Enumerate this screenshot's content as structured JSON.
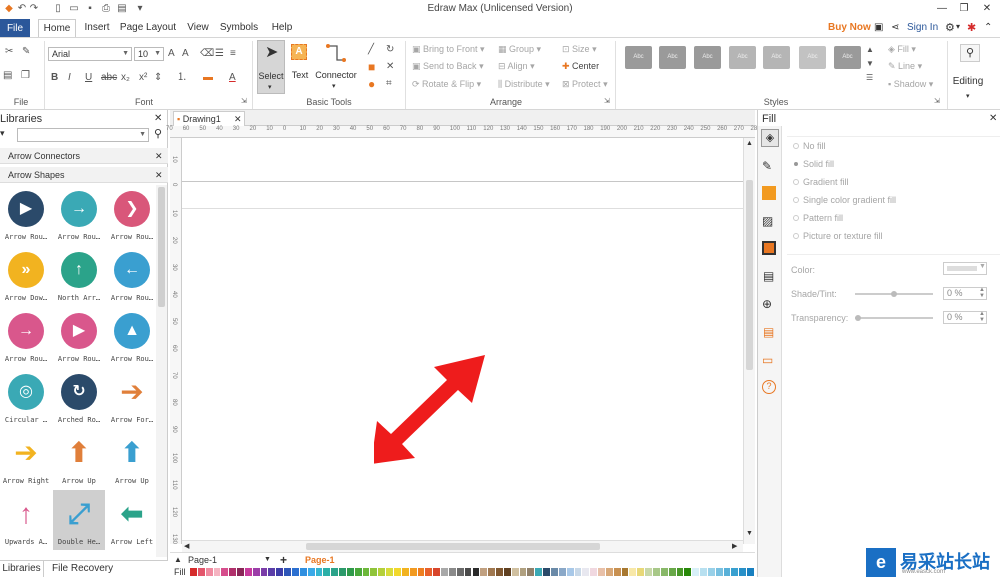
{
  "app": {
    "title": "Edraw Max (Unlicensed Version)"
  },
  "quick_access": [
    "app-icon",
    "undo-icon",
    "redo-icon",
    "new-icon",
    "open-icon",
    "save-icon",
    "print-icon",
    "export-icon",
    "customize-icon"
  ],
  "window_controls": [
    "minimize-icon",
    "restore-icon",
    "close-icon"
  ],
  "tabs": [
    {
      "label": "File"
    },
    {
      "label": "Home"
    },
    {
      "label": "Insert"
    },
    {
      "label": "Page Layout"
    },
    {
      "label": "View"
    },
    {
      "label": "Symbols"
    },
    {
      "label": "Help"
    }
  ],
  "account": {
    "buy_now": "Buy Now",
    "sign_in": "Sign In"
  },
  "ribbon": {
    "groups": {
      "file": "File",
      "font": "Font",
      "basic_tools": "Basic Tools",
      "arrange": "Arrange",
      "styles": "Styles"
    },
    "font_name": "Arial",
    "font_size": "10",
    "tools": {
      "select": "Select",
      "text": "Text",
      "connector": "Connector"
    },
    "arrange": {
      "bring_to_front": "Bring to Front",
      "send_to_back": "Send to Back",
      "rotate_flip": "Rotate & Flip",
      "group": "Group",
      "align": "Align",
      "distribute": "Distribute",
      "size": "Size",
      "center": "Center",
      "protect": "Protect"
    },
    "style_swatch": "Abc",
    "style_options": {
      "fill": "Fill",
      "line": "Line",
      "shadow": "Shadow"
    },
    "editing": "Editing"
  },
  "libraries": {
    "title": "Libraries",
    "search_value": "",
    "sections": [
      "Arrow Connectors",
      "Arrow Shapes"
    ],
    "shapes": [
      {
        "label": "Arrow Rou…",
        "color": "#2b4a6a"
      },
      {
        "label": "Arrow Rou…",
        "color": "#3aa9b5"
      },
      {
        "label": "Arrow Rou…",
        "color": "#d9577a"
      },
      {
        "label": "Arrow Dow…",
        "color": "#f2b320"
      },
      {
        "label": "North Arr…",
        "color": "#2ba38a"
      },
      {
        "label": "Arrow Rou…",
        "color": "#3a9fd0"
      },
      {
        "label": "Arrow Rou…",
        "color": "#d9578c"
      },
      {
        "label": "Arrow Rou…",
        "color": "#d9578c"
      },
      {
        "label": "Arrow Rou…",
        "color": "#3a9fd0"
      },
      {
        "label": "Circular …",
        "color": "#3aa9b5"
      },
      {
        "label": "Arched Ro…",
        "color": "#2b4a6a"
      },
      {
        "label": "Arrow For…",
        "color": "#e07f3a"
      },
      {
        "label": "Arrow Right",
        "color": "#f2b320"
      },
      {
        "label": "Arrow Up",
        "color": "#e07f3a"
      },
      {
        "label": "Arrow Up",
        "color": "#3a9fd0"
      },
      {
        "label": "Upwards A…",
        "color": "#d9578c"
      },
      {
        "label": "Double He…",
        "color": "#3a9fd0"
      },
      {
        "label": "Arrow Left",
        "color": "#2ba38a"
      }
    ],
    "bottom_tabs": [
      "Libraries",
      "File Recovery"
    ]
  },
  "document": {
    "tab": "Drawing1",
    "ruler_h": [
      "70",
      "60",
      "50",
      "40",
      "30",
      "20",
      "10",
      "0",
      "10",
      "20",
      "30",
      "40",
      "50",
      "60",
      "70",
      "80",
      "90",
      "100",
      "110",
      "120",
      "130",
      "140",
      "150",
      "160",
      "170",
      "180",
      "190",
      "200",
      "210",
      "220",
      "230",
      "240",
      "250",
      "260",
      "270",
      "280"
    ],
    "ruler_v": [
      "10",
      "0",
      "10",
      "20",
      "30",
      "40",
      "50",
      "60",
      "70",
      "80",
      "90",
      "100",
      "110",
      "120",
      "130"
    ],
    "arrow_color": "#ee1c1c",
    "page_select": "Page-1",
    "page_tab": "Page-1",
    "fill_label": "Fill"
  },
  "fill_panel": {
    "title": "Fill",
    "options": [
      "No fill",
      "Solid fill",
      "Gradient fill",
      "Single color gradient fill",
      "Pattern fill",
      "Picture or texture fill"
    ],
    "color_label": "Color:",
    "shade_label": "Shade/Tint:",
    "shade_value": "0 %",
    "shade_level": 0.5,
    "transparency_label": "Transparency:",
    "transparency_value": "0 %",
    "transparency_level": 0,
    "strip_icons": [
      "fill-icon",
      "line-icon",
      "shadow-icon",
      "image-icon",
      "layer-icon",
      "page-icon",
      "map-icon",
      "attachment-icon",
      "comment-icon",
      "help-icon"
    ]
  },
  "colors": {
    "accent": "#e87722",
    "palette": [
      "#d52b2b",
      "#e3556b",
      "#f08aa0",
      "#f5b3c1",
      "#d64d8c",
      "#b0306b",
      "#8a2657",
      "#c83a9c",
      "#9c3da8",
      "#7a3ca8",
      "#5a3da8",
      "#3d3da8",
      "#2d56b8",
      "#2b6fd0",
      "#2f8fe0",
      "#3aa9e8",
      "#35b5d0",
      "#2bb0a8",
      "#2ba38a",
      "#2b9a6a",
      "#2f9a4a",
      "#4aa83a",
      "#6cb83a",
      "#8fc43a",
      "#b4d03a",
      "#d8dc3a",
      "#f2d82b",
      "#f2b320",
      "#f29a20",
      "#ee7f20",
      "#e8602b",
      "#d8452b",
      "#a8a8a8",
      "#8a8a8a",
      "#6a6a6a",
      "#4a4a4a",
      "#2a2a2a",
      "#c0a080",
      "#a07850",
      "#805830",
      "#604020",
      "#d0c0a0",
      "#b0a080",
      "#90806a",
      "#3aa9b5",
      "#2b4a6a",
      "#6a8aa8",
      "#8aa8c8",
      "#a8c8e8",
      "#c8d8e8",
      "#e8e8f0",
      "#f0d8e0",
      "#e8c0a8",
      "#d8a878",
      "#c89050",
      "#a87830",
      "#f8e8a8",
      "#e8d878",
      "#c8d8a8",
      "#a8c888",
      "#88b868",
      "#68a848",
      "#489828",
      "#288808",
      "#d8f0f8",
      "#b8e0f0",
      "#98d0e8",
      "#78c0e0",
      "#58b0d8",
      "#38a0d0",
      "#2890c8",
      "#1880c0"
    ]
  },
  "watermark": {
    "text": "易采站长站",
    "sub": "www.easck.com"
  }
}
